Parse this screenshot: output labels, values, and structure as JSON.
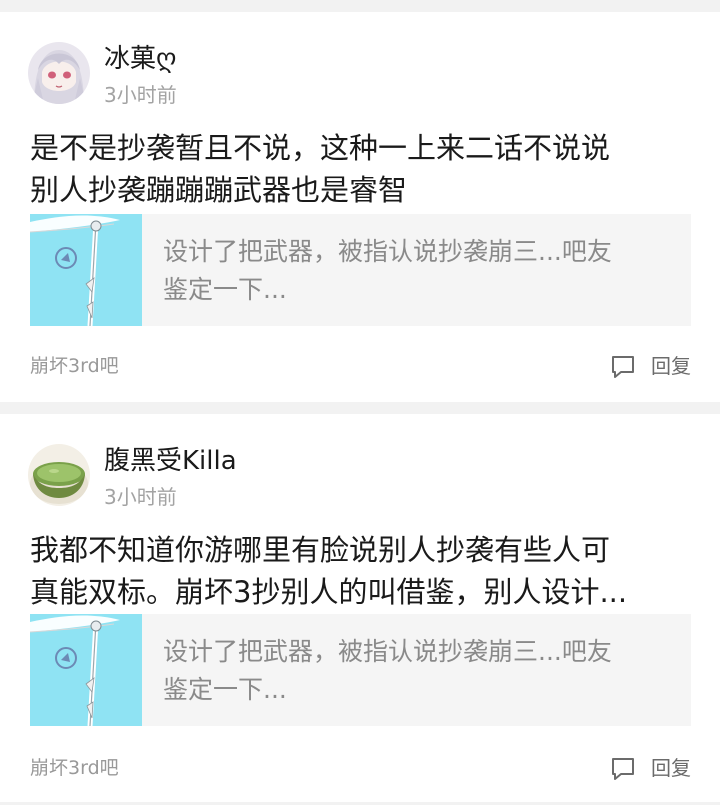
{
  "posts": [
    {
      "username": "冰菓ღ",
      "time": "3小时前",
      "content_lines": [
        "是不是抄袭暂且不说，这种一上来二话不说说",
        "别人抄袭蹦蹦蹦武器也是睿智"
      ],
      "quote_lines": [
        "设计了把武器，被指认说抄袭崩三...吧友",
        "鉴定一下..."
      ],
      "forum": "崩坏3rd吧",
      "reply_label": "回复"
    },
    {
      "username": "腹黑受Killa",
      "time": "3小时前",
      "content_lines": [
        "我都不知道你游哪里有脸说别人抄袭有些人可",
        "真能双标。崩坏3抄别人的叫借鉴，别人设计..."
      ],
      "quote_lines": [
        "设计了把武器，被指认说抄袭崩三...吧友",
        "鉴定一下..."
      ],
      "forum": "崩坏3rd吧",
      "reply_label": "回复"
    }
  ]
}
